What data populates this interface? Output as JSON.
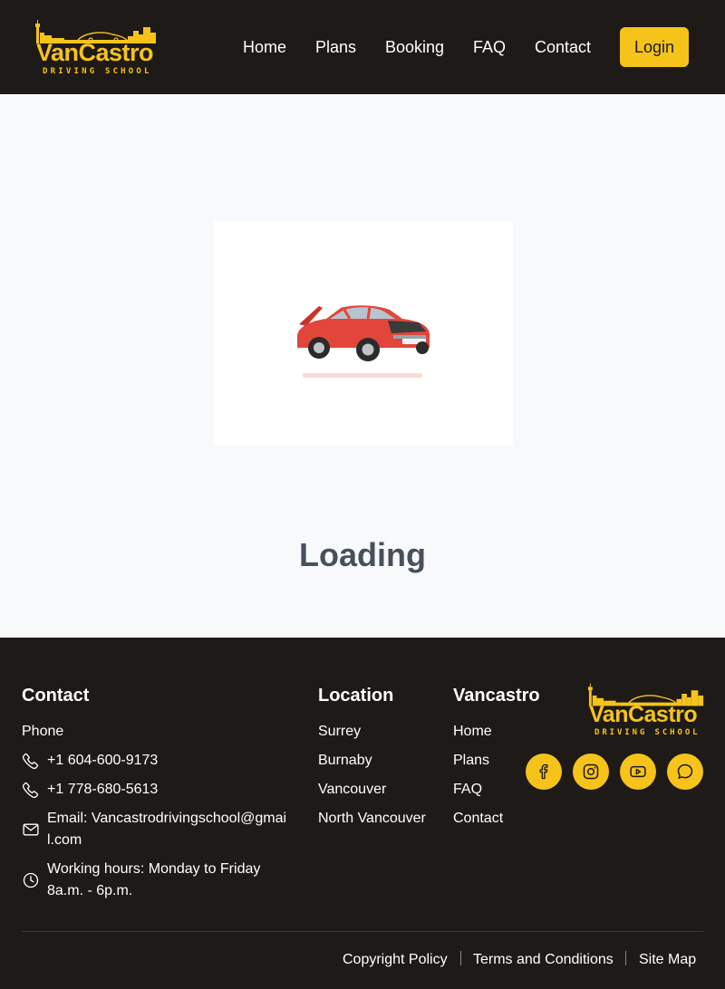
{
  "header": {
    "logo": {
      "word": "VanCastro",
      "subtitle": "DRIVING SCHOOL"
    },
    "nav": [
      "Home",
      "Plans",
      "Booking",
      "FAQ",
      "Contact"
    ],
    "login_label": "Login"
  },
  "main": {
    "loading_text": "Loading",
    "loader_icon": "red-car-animation"
  },
  "footer": {
    "contact": {
      "title": "Contact",
      "phone_label": "Phone",
      "phone_1": "+1 604-600-9173",
      "phone_2": "+1 778-680-5613",
      "email": "Email: Vancastrodrivingschool@gmail.com",
      "hours": "Working hours: Monday to Friday 8a.m. - 6p.m."
    },
    "location": {
      "title": "Location",
      "items": [
        "Surrey",
        "Burnaby",
        "Vancouver",
        "North Vancouver"
      ]
    },
    "vancastro": {
      "title": "Vancastro",
      "items": [
        "Home",
        "Plans",
        "FAQ",
        "Contact"
      ]
    },
    "logo": {
      "word": "VanCastro",
      "subtitle": "DRIVING SCHOOL"
    },
    "social": [
      "facebook-icon",
      "instagram-icon",
      "youtube-icon",
      "chat-icon"
    ],
    "legal": [
      "Copyright Policy",
      "Terms and Conditions",
      "Site Map"
    ]
  },
  "colors": {
    "brand_yellow": "#f6c31b",
    "dark_bg": "#1e1a18",
    "main_bg": "#f7f9fb",
    "loading_text": "#48505c",
    "car_red": "#e2463b"
  }
}
